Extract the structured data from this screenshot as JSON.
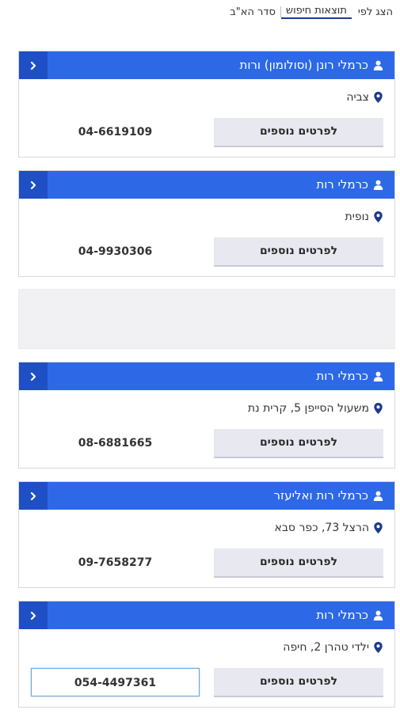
{
  "sort": {
    "label": "הצג לפי",
    "options": [
      {
        "label": "תוצאות חיפוש",
        "active": true
      },
      {
        "label": "סדר הא\"ב",
        "active": false
      }
    ]
  },
  "more_label": "לפרטים נוספים",
  "results": [
    {
      "name": "כרמלי רונן (וסולומון) ורות",
      "address": "צביה",
      "phone": "04-6619109"
    },
    {
      "name": "כרמלי רות",
      "address": "נופית",
      "phone": "04-9930306"
    },
    {
      "name": "כרמלי רות",
      "address": "משעול הסייפן 5, קרית נת",
      "phone": "08-6881665"
    },
    {
      "name": "כרמלי רות ואליעזר",
      "address": "הרצל 73, כפר סבא",
      "phone": "09-7658277"
    },
    {
      "name": "כרמלי רות",
      "address": "ילדי טהרן 2, חיפה",
      "phone": "054-4497361"
    }
  ],
  "colors": {
    "header": "#2d69e6",
    "toggle": "#1f4fc4",
    "pin": "#1e3a8a",
    "button": "#e8e8f0"
  }
}
